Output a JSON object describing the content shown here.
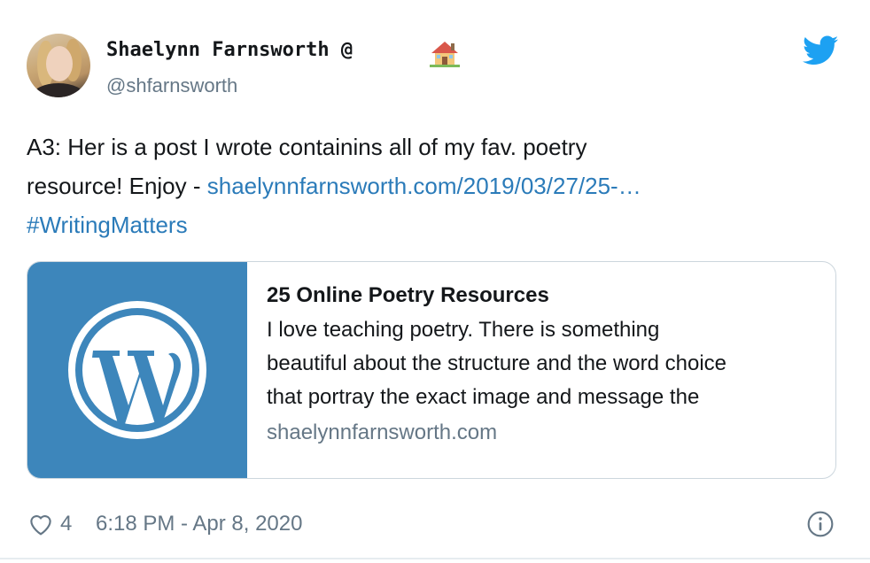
{
  "author": {
    "display_name": "Shaelynn Farnsworth @",
    "handle": "@shfarnsworth",
    "name_emoji_icon": "house-icon"
  },
  "tweet": {
    "text_line1": "A3: Her is a post I wrote containins all of my fav. poetry",
    "text_line2_prefix": "resource! Enjoy - ",
    "link_text": "shaelynnfarnsworth.com/2019/03/27/25-…",
    "hashtag": "#WritingMatters"
  },
  "card": {
    "title": "25 Online Poetry Resources",
    "description_lines": [
      "I love teaching poetry. There is something",
      "beautiful about the structure and the word choice",
      "that portray the exact image and message the"
    ],
    "domain": "shaelynnfarnsworth.com",
    "thumbnail_icon": "wordpress-logo-icon",
    "thumbnail_color": "#3d86bb"
  },
  "footer": {
    "like_count": "4",
    "timestamp": "6:18 PM - Apr 8, 2020"
  },
  "colors": {
    "link": "#2b7bb9",
    "muted": "#657786",
    "twitter_blue": "#1da1f2"
  }
}
